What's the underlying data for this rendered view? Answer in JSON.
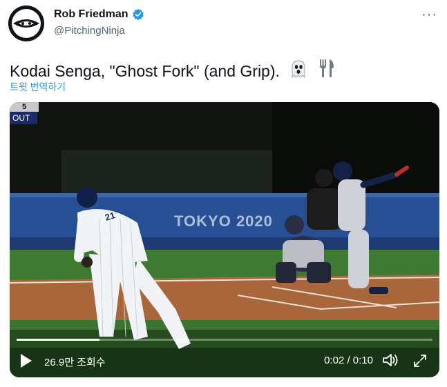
{
  "author": {
    "display_name": "Rob Friedman",
    "handle": "@PitchingNinja",
    "verified": true,
    "avatar_icon": "baseball-ninja-avatar"
  },
  "tweet": {
    "text": "Kodai Senga, \"Ghost Fork\" (and Grip).",
    "emojis": [
      "ghost-icon",
      "fork-and-knife-icon"
    ],
    "translate_label": "트윗 번역하기"
  },
  "media": {
    "overlay_score": "5",
    "overlay_out": "OUT",
    "wall_text": "TOKYO 2020",
    "pitcher_number": "21",
    "views_label": "26.9만 조회수",
    "time_label": "0:02 / 0:10",
    "progress_fraction": 0.2,
    "icons": [
      "play-icon",
      "volume-icon",
      "fullscreen-icon"
    ]
  },
  "colors": {
    "verified_blue": "#1d9bf0",
    "link_blue": "#1d9bf0",
    "secondary_text": "#536471"
  }
}
